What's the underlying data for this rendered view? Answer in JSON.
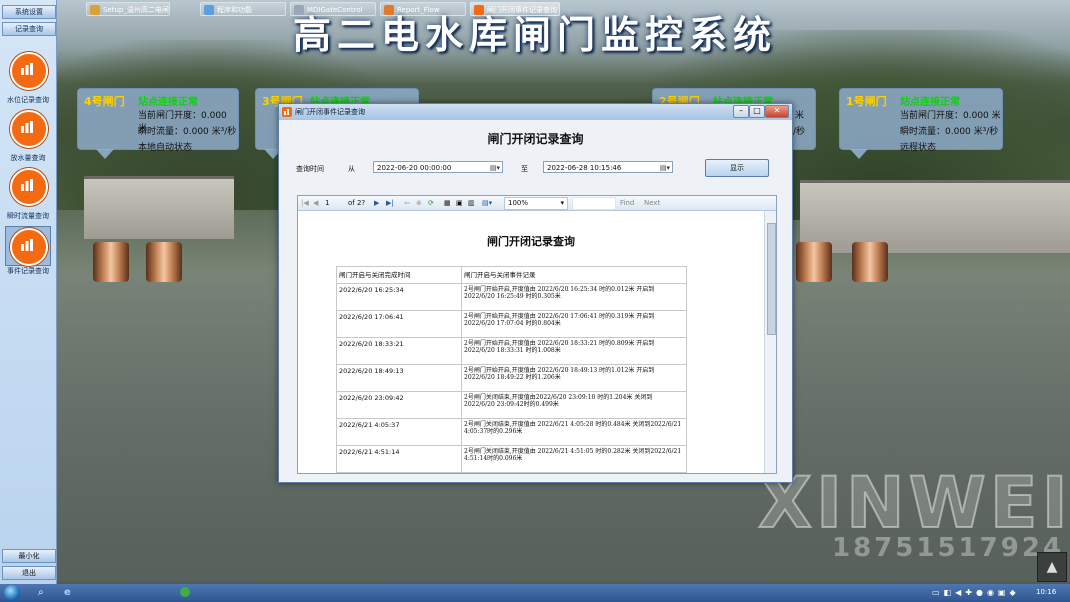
{
  "app": {
    "title": "高二电水库闸门监控系统"
  },
  "sidebar": {
    "top_buttons": [
      "系统设置",
      "记录查询"
    ],
    "items": [
      {
        "label": "水位记录查询",
        "icon": "bar-chart-icon"
      },
      {
        "label": "放水量查询",
        "icon": "bar-chart-icon"
      },
      {
        "label": "瞬时流量查询",
        "icon": "bar-chart-icon"
      },
      {
        "label": "事件记录查询",
        "icon": "bar-chart-icon"
      }
    ],
    "bottom_buttons": [
      "最小化",
      "退出"
    ]
  },
  "gates": [
    {
      "name": "4号闸门",
      "status": "站点连接正常",
      "opening": "当前闸门开度：0.000 米",
      "flow": "瞬时流量：0.000 米³/秒",
      "mode": "本地自动状态"
    },
    {
      "name": "3号闸门",
      "status": "站点连接正常"
    },
    {
      "name": "2号闸门",
      "status": "站点连接正常",
      "opening": "米",
      "flow": "/秒"
    },
    {
      "name": "1号闸门",
      "status": "站点连接正常",
      "opening": "当前闸门开度：0.000 米",
      "flow": "瞬时流量：0.000 米³/秒",
      "mode": "远程状态"
    }
  ],
  "dialog": {
    "window_title": "闸门开闭事件记录查询",
    "heading": "闸门开闭记录查询",
    "query_label": "查询时间",
    "from_label": "从",
    "from_value": "2022-06-20 00:00:00",
    "to_label": "至",
    "to_value": "2022-06-28 10:15:46",
    "show_button": "显示",
    "toolbar": {
      "page_current": "1",
      "page_of": "of 2?",
      "zoom": "100%",
      "find": "Find",
      "next": "Next"
    },
    "report": {
      "title": "闸门开闭记录查询",
      "columns": [
        "闸门开启与关闭完成时间",
        "闸门开启与关闭事件记录"
      ],
      "rows": [
        [
          "2022/6/20 16:25:34",
          "2号闸门开始开启,开度值由 2022/6/20 16:25:34 时的0.012米 开启到 2022/6/20 16:25:49 时的0.305米"
        ],
        [
          "2022/6/20 17:06:41",
          "2号闸门开始开启,开度值由 2022/6/20 17:06:41 时的0.319米 开启到 2022/6/20 17:07:04 时的0.804米"
        ],
        [
          "2022/6/20 18:33:21",
          "2号闸门开始开启,开度值由 2022/6/20 18:33:21 时的0.809米 开启到 2022/6/20 18:33:31 时的1.008米"
        ],
        [
          "2022/6/20 18:49:13",
          "2号闸门开始开启,开度值由 2022/6/20 18:49:13 时的1.012米 开启到 2022/6/20 18:49:22 时的1.206米"
        ],
        [
          "2022/6/20 23:09:42",
          "2号闸门关闭结束,开度值由2022/6/20 23:09:10 时的1.204米 关闭到 2022/6/20 23:09:42时的0.499米"
        ],
        [
          "2022/6/21 4:05:37",
          "2号闸门关闭结束,开度值由 2022/6/21 4:05:28 时的0.484米 关闭到2022/6/21 4:05:37时的0.296米"
        ],
        [
          "2022/6/21 4:51:14",
          "2号闸门关闭结束,开度值由 2022/6/21 4:51:05 时的0.282米 关闭到2022/6/21 4:51:14时的0.096米"
        ]
      ]
    }
  },
  "watermark": {
    "brand": "XINWEI",
    "phone": "18751517924"
  },
  "taskbar": {
    "items": [
      "Setup_温州高二电闸...",
      "程序和功能",
      "MDIGateControl",
      "Report_Flow",
      "闸门开闭事件记录查询"
    ],
    "time": "10:16"
  },
  "colors": {
    "accent_orange": "#f36a12",
    "status_green": "#10d010",
    "gate_name_yellow": "#ffd200"
  }
}
